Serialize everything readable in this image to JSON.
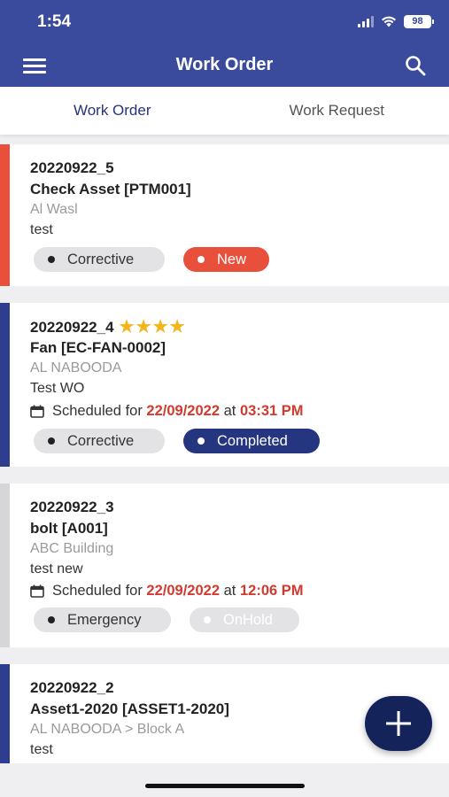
{
  "status": {
    "time": "1:54",
    "battery": "98"
  },
  "header": {
    "title": "Work Order"
  },
  "tabs": [
    {
      "label": "Work Order"
    },
    {
      "label": "Work Request"
    }
  ],
  "work_orders": [
    {
      "id": "20220922_5",
      "asset": "Check Asset [PTM001]",
      "location": "Al Wasl",
      "description": "test",
      "type": "Corrective",
      "status": "New",
      "bar_color": "#e8503c",
      "status_color": "#e8503c"
    },
    {
      "id": "20220922_4",
      "rating": "★★★★",
      "asset": "Fan [EC-FAN-0002]",
      "location": "AL NABOODA",
      "description": "Test WO",
      "schedule_prefix": "Scheduled for",
      "schedule_date": "22/09/2022",
      "schedule_at": "at",
      "schedule_time": "03:31 PM",
      "type": "Corrective",
      "status": "Completed",
      "bar_color": "#2e3d8f",
      "status_color": "#253580"
    },
    {
      "id": "20220922_3",
      "asset": "bolt [A001]",
      "location": "ABC Building",
      "description": "test new",
      "schedule_prefix": "Scheduled for",
      "schedule_date": "22/09/2022",
      "schedule_at": "at",
      "schedule_time": "12:06 PM",
      "type": "Emergency",
      "status": "OnHold",
      "bar_color": "#d6d6d8",
      "status_color": "#e3e3e5"
    },
    {
      "id": "20220922_2",
      "asset": "Asset1-2020 [ASSET1-2020]",
      "location": "AL NABOODA > Block A",
      "description": "test",
      "bar_color": "#2e3d8f"
    }
  ],
  "icons": {
    "menu": "menu-icon",
    "search": "search-icon",
    "calendar": "calendar-icon",
    "add": "plus-icon"
  }
}
